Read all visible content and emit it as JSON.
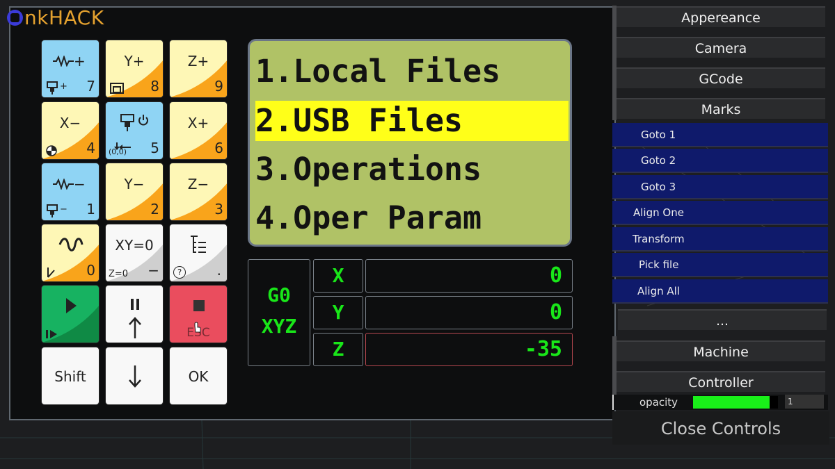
{
  "logo": {
    "text": "nkHACK"
  },
  "keypad": {
    "feed_plus": {
      "top": "+",
      "num": "7",
      "sub": "+"
    },
    "y_plus": {
      "top": "Y+",
      "num": "8"
    },
    "z_plus": {
      "top": "Z+",
      "num": "9"
    },
    "x_minus": {
      "top": "X−",
      "num": "4"
    },
    "spindle": {
      "num": "5",
      "sub": "(0,0)"
    },
    "x_plus": {
      "top": "X+",
      "num": "6"
    },
    "feed_minus": {
      "top": "−",
      "num": "1",
      "sub": "−"
    },
    "y_minus": {
      "top": "Y−",
      "num": "2"
    },
    "z_minus": {
      "top": "Z−",
      "num": "3"
    },
    "wave": {
      "num": "0"
    },
    "xy_zero": {
      "top": "XY=0",
      "num": "−",
      "sub": "Z=0"
    },
    "menu": {
      "num": ".",
      "sub": "?"
    },
    "stop": {
      "sub": "ESC"
    },
    "shift": {
      "top": "Shift"
    },
    "ok": {
      "top": "OK"
    }
  },
  "lcd": {
    "lines": [
      "1.Local Files",
      "2.USB Files",
      "3.Operations",
      "4.Oper Param"
    ],
    "selected_index": 1
  },
  "dro": {
    "mode_line1": "G0",
    "mode_line2": "XYZ",
    "axes": [
      {
        "label": "X",
        "value": "0"
      },
      {
        "label": "Y",
        "value": "0"
      },
      {
        "label": "Z",
        "value": "-35"
      }
    ]
  },
  "sidebar": {
    "buttons": [
      "Appereance",
      "Camera",
      "GCode",
      "Marks"
    ],
    "marks": [
      "Goto 1",
      "Goto 2",
      "Goto 3",
      "Align One",
      "Transform",
      "Pick file",
      "Align All"
    ],
    "more": "...",
    "machine": "Machine",
    "controller": "Controller",
    "opacity_label": "opacity",
    "opacity_value": "1",
    "opacity_fraction": 0.9,
    "close": "Close Controls"
  },
  "colors": {
    "lcd_bg": "#b0c266",
    "lcd_highlight": "#ffff19",
    "dro_text": "#19e619",
    "mark_bg": "#0f1a6b",
    "logo": "#e5a22f",
    "accent_blue": "#8fd4f4",
    "accent_yellow": "#fef7b6",
    "accent_orange": "#f9a41b"
  }
}
